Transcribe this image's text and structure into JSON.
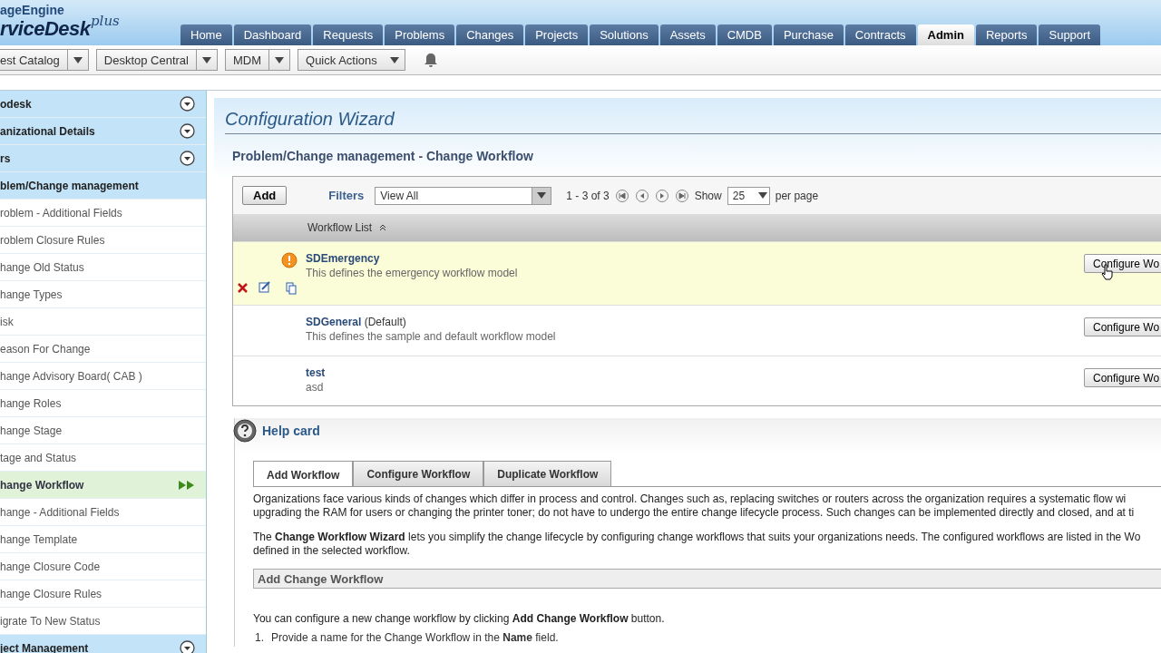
{
  "logo": {
    "line1": "ageEngine",
    "line2": "rviceDesk",
    "plus": "plus"
  },
  "nav_tabs": [
    {
      "label": "Home",
      "selected": false
    },
    {
      "label": "Dashboard",
      "selected": false
    },
    {
      "label": "Requests",
      "selected": false
    },
    {
      "label": "Problems",
      "selected": false
    },
    {
      "label": "Changes",
      "selected": false
    },
    {
      "label": "Projects",
      "selected": false
    },
    {
      "label": "Solutions",
      "selected": false
    },
    {
      "label": "Assets",
      "selected": false
    },
    {
      "label": "CMDB",
      "selected": false
    },
    {
      "label": "Purchase",
      "selected": false
    },
    {
      "label": "Contracts",
      "selected": false
    },
    {
      "label": "Admin",
      "selected": true
    },
    {
      "label": "Reports",
      "selected": false
    },
    {
      "label": "Support",
      "selected": false
    }
  ],
  "toolbar": [
    "est Catalog",
    "Desktop Central",
    "MDM"
  ],
  "quick_actions": "Quick Actions",
  "sidebar": [
    {
      "label": "odesk",
      "expanded": false
    },
    {
      "label": "anizational Details",
      "expanded": false
    },
    {
      "label": "rs",
      "expanded": false
    },
    {
      "label": "blem/Change management",
      "expanded": true,
      "children": [
        {
          "label": "roblem - Additional Fields",
          "selected": false
        },
        {
          "label": "roblem Closure Rules",
          "selected": false
        },
        {
          "label": "hange Old Status",
          "selected": false
        },
        {
          "label": "hange Types",
          "selected": false
        },
        {
          "label": "isk",
          "selected": false
        },
        {
          "label": "eason For Change",
          "selected": false
        },
        {
          "label": "hange Advisory Board( CAB )",
          "selected": false
        },
        {
          "label": "hange Roles",
          "selected": false
        },
        {
          "label": "hange Stage",
          "selected": false
        },
        {
          "label": "tage and Status",
          "selected": false
        },
        {
          "label": "hange Workflow",
          "selected": true
        },
        {
          "label": "hange - Additional Fields",
          "selected": false
        },
        {
          "label": "hange Template",
          "selected": false
        },
        {
          "label": "hange Closure Code",
          "selected": false
        },
        {
          "label": "hange Closure Rules",
          "selected": false
        },
        {
          "label": "igrate To New Status",
          "selected": false
        }
      ]
    },
    {
      "label": "ject Management",
      "expanded": false
    }
  ],
  "page_title": "Configuration Wizard",
  "subtitle": "Problem/Change management - Change Workflow",
  "list_toolbar": {
    "add": "Add",
    "filters_label": "Filters",
    "filter_value": "View All",
    "range": "1 - 3 of 3",
    "show_label": "Show",
    "page_size": "25",
    "per_page": "per page"
  },
  "table": {
    "column": "Workflow List",
    "rows": [
      {
        "name": "SDEmergency",
        "description": "This defines the emergency workflow model",
        "emergency": true,
        "highlighted": true,
        "button": "Configure Wo"
      },
      {
        "name": "SDGeneral",
        "suffix": "(Default)",
        "description": "This defines the sample and default workflow model",
        "emergency": false,
        "highlighted": false,
        "button": "Configure Wo"
      },
      {
        "name": "test",
        "description": "asd",
        "emergency": false,
        "highlighted": false,
        "button": "Configure Wo"
      }
    ]
  },
  "help": {
    "title": "Help card",
    "tabs": [
      {
        "label": "Add Workflow",
        "selected": true
      },
      {
        "label": "Configure Workflow",
        "selected": false
      },
      {
        "label": "Duplicate Workflow",
        "selected": false
      }
    ],
    "paragraphs": [
      [
        "Organizations face various kinds of changes which differ in process and control. Changes such as, replacing switches or routers across the organization requires a systematic flow wi",
        "upgrading the RAM for users or changing the printer toner; do not have to undergo the entire change lifecycle process. Such changes can be implemented directly and closed, and at ti"
      ],
      [
        "The **Change Workflow Wizard** lets you simplify the change lifecycle by configuring change workflows that suits your organizations needs. The configured workflows are listed in the Wo",
        "defined in the selected workflow."
      ]
    ],
    "section_heading": "Add Change Workflow",
    "intro": "You can configure a new change workflow by clicking **Add Change Workflow** button.",
    "steps": [
      {
        "number": "1.",
        "text": "Provide a name for the Change Workflow in the **Name** field."
      }
    ]
  }
}
